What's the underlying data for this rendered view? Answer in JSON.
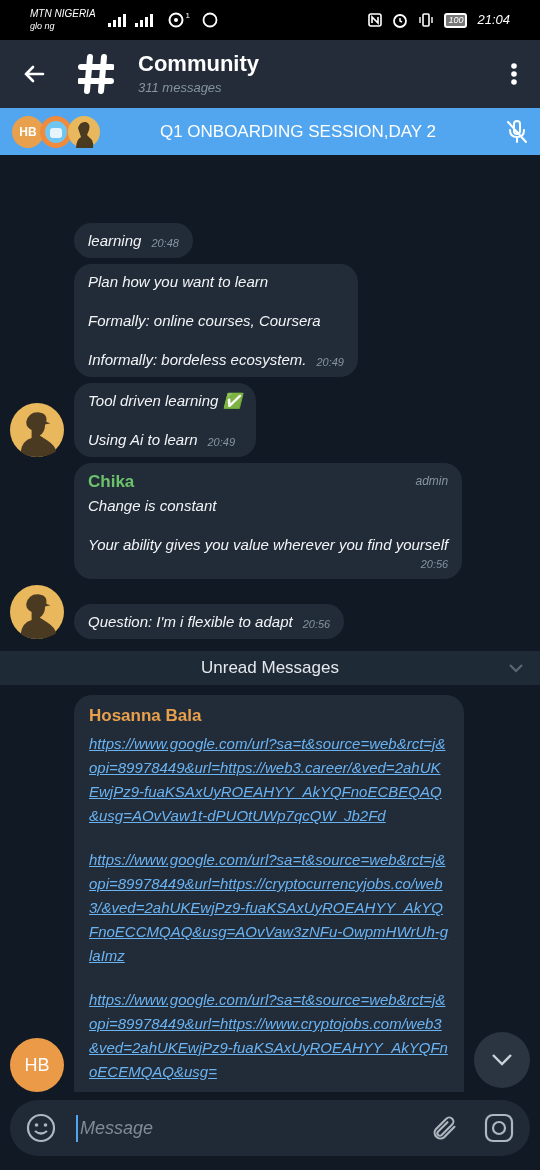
{
  "status_bar": {
    "carrier": "MTN NIGERIA",
    "carrier_2": "glo ng",
    "notification_count": "1",
    "battery": "100",
    "time": "21:04"
  },
  "header": {
    "title": "Community",
    "subtitle": "311 messages"
  },
  "call_banner": {
    "initials": "HB",
    "title": "Q1 ONBOARDING SESSION,DAY 2",
    "muted": true
  },
  "messages": [
    {
      "paragraphs": [
        "learning"
      ],
      "time": "20:48",
      "avatar": false
    },
    {
      "paragraphs": [
        "Plan how you want to learn",
        "Formally: online courses, Coursera",
        "Informally: bordeless ecosystem."
      ],
      "time": "20:49",
      "avatar": false
    },
    {
      "paragraphs": [
        "Tool driven learning ✅",
        "Using Ai to learn"
      ],
      "time": "20:49",
      "avatar": true
    },
    {
      "sender": "Chika",
      "color": "#6cc26a",
      "role": "admin",
      "paragraphs": [
        "Change is constant",
        "Your ability gives you value wherever you find yourself"
      ],
      "time": "20:56",
      "avatar": false
    },
    {
      "paragraphs": [
        "Question: I'm i flexible to adapt"
      ],
      "time": "20:56",
      "avatar": true
    }
  ],
  "unread_divider": "Unread Messages",
  "last_message": {
    "sender": "Hosanna Bala",
    "color": "#e8a04c",
    "initials": "HB",
    "links": [
      "https://www.google.com/url?sa=t&source=web&rct=j&opi=89978449&url=https://web3.career/&ved=2ahUKEwjPz9-fuaKSAxUyROEAHYY_AkYQFnoECBEQAQ&usg=AOvVaw1t-dPUOtUWp7qcQW_Jb2Fd",
      "https://www.google.com/url?sa=t&source=web&rct=j&opi=89978449&url=https://cryptocurrencyjobs.co/web3/&ved=2ahUKEwjPz9-fuaKSAxUyROEAHYY_AkYQFnoECCMQAQ&usg=AOvVaw3zNFu-OwpmHWrUh-glaImz",
      "https://www.google.com/url?sa=t&source=web&rct=j&opi=89978449&url=https://www.cryptojobs.com/web3&ved=2ahUKEwjPz9-fuaKSAxUyROEAHYY_AkYQFnoECEMQAQ&usg="
    ]
  },
  "composer": {
    "placeholder": "Message"
  }
}
